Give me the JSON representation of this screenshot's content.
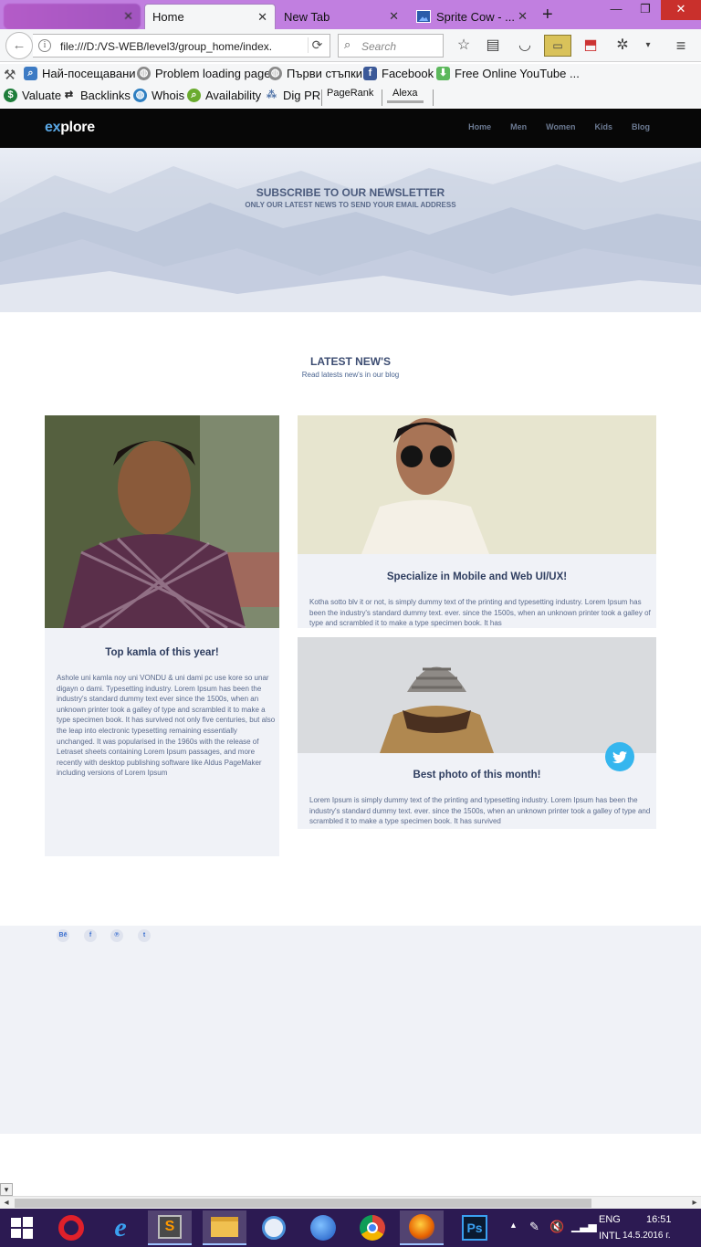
{
  "browser": {
    "tabs": [
      {
        "label": ""
      },
      {
        "label": "Home"
      },
      {
        "label": "New Tab"
      },
      {
        "label": "Sprite Cow - ..."
      }
    ],
    "url": "file:///D:/VS-WEB/level3/group_home/index.",
    "search_placeholder": "Search",
    "bookmarks_row1": [
      "Най-посещавани",
      "Problem loading page",
      "Първи стъпки",
      "Facebook",
      "Free Online YouTube ..."
    ],
    "bookmarks_row2": [
      "Valuate",
      "Backlinks",
      "Whois",
      "Availability",
      "Dig PR",
      "PageRank",
      "Alexa"
    ]
  },
  "site": {
    "logo_ex": "ex",
    "logo_rest": "plore",
    "nav": [
      "Home",
      "Men",
      "Women",
      "Kids",
      "Blog"
    ],
    "hero": {
      "title": "SUBSCRIBE TO OUR NEWSLETTER",
      "subtitle": "ONLY OUR LATEST NEWS TO SEND YOUR EMAIL ADDRESS"
    },
    "news": {
      "title": "LATEST NEW'S",
      "subtitle": "Read latests new's in our blog"
    },
    "cards": [
      {
        "title": "Top kamla of this year!",
        "text": "Ashole uni kamla noy uni VONDU & uni dami pc use kore so unar digayn o dami. Typesetting industry. Lorem Ipsum has been the industry's standard dummy text ever since the 1500s, when an unknown printer took a galley of type and scrambled it to make a type specimen book. It has survived not only five centuries, but also the leap into electronic typesetting remaining essentially unchanged. It was popularised in the 1960s with the release of Letraset sheets containing Lorem Ipsum passages, and more recently with desktop publishing software like Aldus PageMaker including versions of Lorem Ipsum"
      },
      {
        "title": "Specialize in Mobile and Web UI/UX!",
        "text": "Kotha sotto blv it or not, is simply dummy text of the printing and typesetting industry. Lorem Ipsum has been the industry's standard dummy text. ever. since the 1500s, when an unknown printer took a galley of type and scrambled it to make a type specimen book. It has"
      },
      {
        "title": "Best photo of this month!",
        "text": "Lorem Ipsum is simply dummy text of the printing and typesetting industry. Lorem Ipsum has been the industry's standard dummy text. ever. since the 1500s, when an unknown printer took a galley of type and scrambled it to make a type specimen book. It has survived"
      }
    ],
    "social": [
      "Bē",
      "f",
      "℗",
      "t"
    ]
  },
  "taskbar": {
    "lang_1": "ENG",
    "lang_2": "INTL",
    "time": "16:51",
    "date": "14.5.2016 г."
  },
  "colors": {
    "tabstrip": "#c17fe0",
    "header_bg": "#070707",
    "accent_blue": "#5aa8e6",
    "heading": "#2f3e60",
    "card_bg": "#f0f2f7",
    "twitter": "#35b6ee",
    "taskbar": "#2c1a52"
  }
}
